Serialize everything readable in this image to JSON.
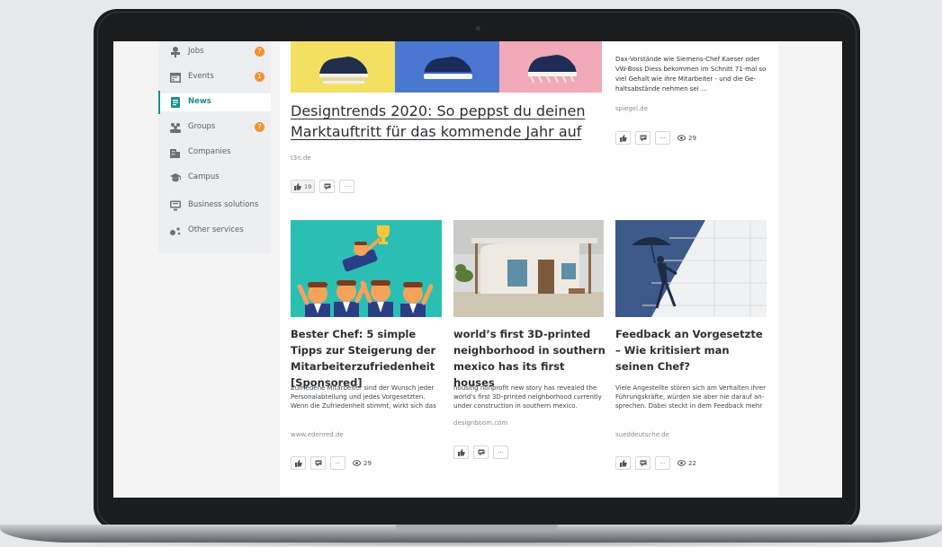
{
  "sidebar": {
    "items": [
      {
        "label": "Jobs",
        "icon": "briefcase-icon",
        "badge": "7"
      },
      {
        "label": "Events",
        "icon": "calendar-icon",
        "badge": "1"
      },
      {
        "label": "News",
        "icon": "news-icon",
        "active": true
      },
      {
        "label": "Groups",
        "icon": "groups-icon",
        "badge": "7"
      },
      {
        "label": "Companies",
        "icon": "building-icon"
      },
      {
        "label": "Campus",
        "icon": "graduation-cap-icon"
      },
      {
        "label": "Business solutions",
        "icon": "presentation-icon"
      },
      {
        "label": "Other services",
        "icon": "dots-icon"
      }
    ]
  },
  "featured": {
    "title": "Designtrends 2020: So peppst du deinen Marktauftritt für das kommende Jahr auf",
    "source": "t3n.de",
    "likes": "19"
  },
  "right_card": {
    "excerpt": "Dax-Vorstände wie Siemens-Chef Kaeser oder VW-Boss Diess bekommen im Schnitt 71-mal so viel Gehalt wie ihre Mitarbeiter - und die Ge­haltsabstände nehmen sei ...",
    "source": "spiegel.de",
    "views": "29"
  },
  "cards": [
    {
      "title": "Bester Chef: 5 simple Tipps zur Steigerung der Mitarbei­terzufriedenheit [Sponsored]",
      "excerpt": "Zufriedene Mitarbeiter sind der Wunsch jeder Personalabteilung und jedes Vorgesetzten. Wenn die Zufriedenheit stimmt, wirkt sich das positiv auf das Betrieb ...",
      "source": "www.edenred.de",
      "views": "29"
    },
    {
      "title": "world’s first 3D-printed neigh­borhood in southern mexico has its first houses",
      "excerpt": "housing nonprofit new story has revealed the world's first 3D-printed neighborhood currently under construction in southern mexico.",
      "source": "designboom.com"
    },
    {
      "title": "Feedback an Vorgesetzte – Wie kritisiert man seinen Chef?",
      "excerpt": "Viele Angestellte stören sich am Verhalten ihrer Führungskräfte, würden sie aber nie darauf an­sprechen. Dabei steckt in dem Feedback mehr als eine Chance - ...",
      "source": "sueddeutsche.de",
      "views": "22"
    }
  ],
  "actions": {
    "more_label": "···"
  },
  "colors": {
    "accent": "#1b8c8c",
    "badge": "#f29231",
    "sidebar_bg": "#eceef0"
  }
}
